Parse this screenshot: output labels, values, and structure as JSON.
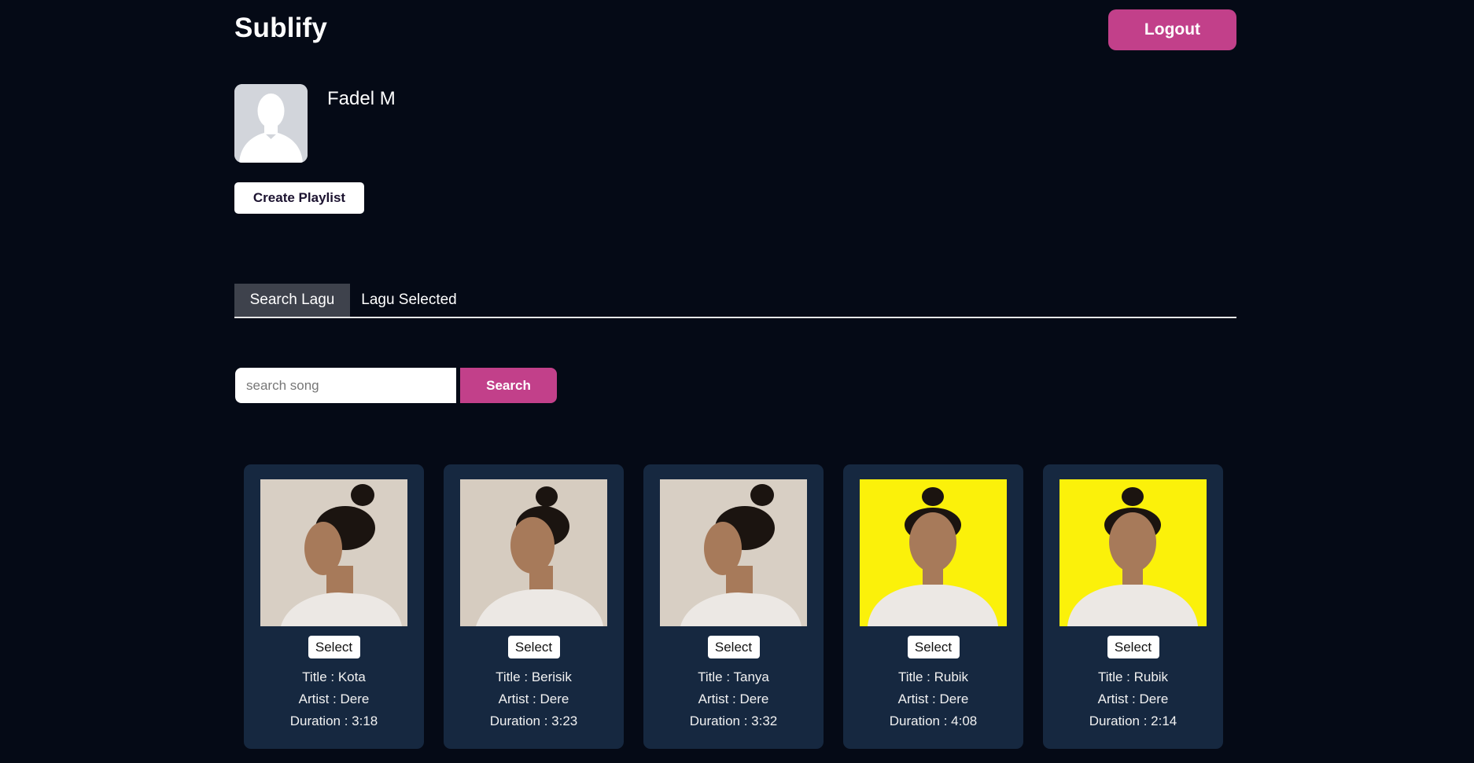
{
  "header": {
    "brand": "Sublify",
    "logout_label": "Logout"
  },
  "profile": {
    "name": "Fadel M",
    "avatar_icon": "user-silhouette-icon",
    "create_playlist_label": "Create Playlist"
  },
  "tabs": [
    {
      "label": "Search Lagu",
      "active": true
    },
    {
      "label": "Lagu Selected",
      "active": false
    }
  ],
  "search": {
    "placeholder": "search song",
    "value": "",
    "button_label": "Search"
  },
  "labels": {
    "title": "Title : ",
    "artist": "Artist : ",
    "duration": "Duration : ",
    "select": "Select"
  },
  "songs": [
    {
      "title": "Kota",
      "artist": "Dere",
      "duration": "3:18",
      "cover": "woman-profile-left-beige",
      "cover_bg": "#d8cfc4"
    },
    {
      "title": "Berisik",
      "artist": "Dere",
      "duration": "3:23",
      "cover": "woman-three-quarter-beige",
      "cover_bg": "#d6ccc0"
    },
    {
      "title": "Tanya",
      "artist": "Dere",
      "duration": "3:32",
      "cover": "woman-profile-down-beige",
      "cover_bg": "#d8cfc4"
    },
    {
      "title": "Rubik",
      "artist": "Dere",
      "duration": "4:08",
      "cover": "woman-front-yellow",
      "cover_bg": "#fbf10a"
    },
    {
      "title": "Rubik",
      "artist": "Dere",
      "duration": "2:14",
      "cover": "woman-front-yellow",
      "cover_bg": "#fbf10a"
    }
  ],
  "colors": {
    "background": "#050a16",
    "accent": "#c2408a",
    "card": "#162840",
    "tab_active": "#3e424c"
  }
}
